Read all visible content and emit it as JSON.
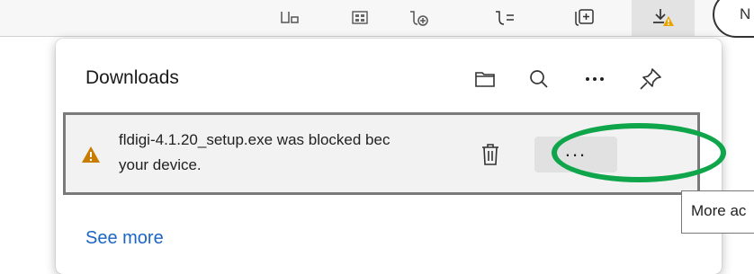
{
  "toolbar": {
    "buttons": [
      {
        "icon": "split-screen-icon"
      },
      {
        "icon": "collections-grid-icon"
      },
      {
        "icon": "add-favorite-icon"
      },
      {
        "icon": "favorites-list-icon"
      },
      {
        "icon": "collections-icon"
      },
      {
        "icon": "downloads-warning-icon",
        "active": true
      }
    ],
    "profile_initial": "N"
  },
  "downloads_panel": {
    "title": "Downloads",
    "header_icons": [
      "open-folder-icon",
      "search-icon",
      "more-options-icon",
      "pin-icon"
    ],
    "item": {
      "status_icon": "warning-icon",
      "status_color": "#c87d00",
      "message_line1": "fldigi-4.1.20_setup.exe was blocked bec",
      "message_line2": "your device.",
      "delete_icon": "trash-icon",
      "more_label": "..."
    },
    "see_more": "See more"
  },
  "tooltip": {
    "text": "More ac"
  },
  "annotation": {
    "color": "#0fa54a"
  }
}
